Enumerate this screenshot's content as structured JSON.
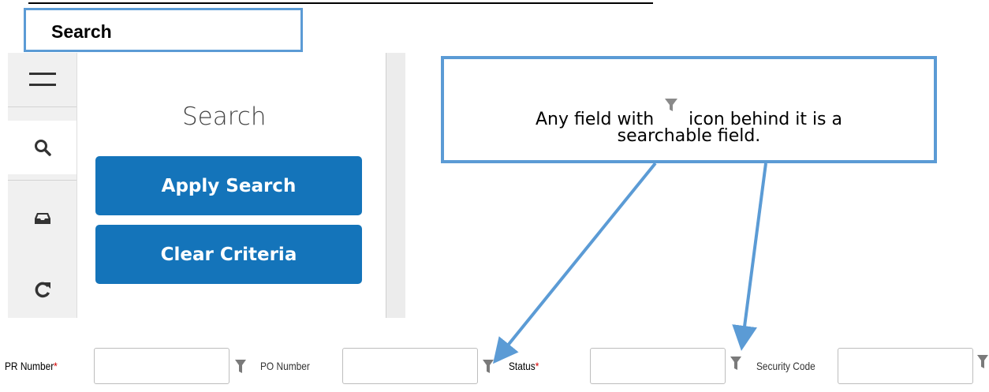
{
  "header": {
    "title": "Search"
  },
  "sidebar": {
    "icons": [
      "menu-icon",
      "search-icon",
      "inbox-icon",
      "refresh-icon"
    ],
    "heading": "Search",
    "apply_label": "Apply Search",
    "clear_label": "Clear Criteria"
  },
  "callout": {
    "line1_before": "Any field with",
    "line1_after": "icon behind it is a",
    "line2": "searchable field."
  },
  "fields": [
    {
      "label": "PR Number",
      "required": "*",
      "value": ""
    },
    {
      "label": "PO Number",
      "required": "",
      "value": ""
    },
    {
      "label": "Status",
      "required": "*",
      "value": ""
    },
    {
      "label": "Security Code",
      "required": "",
      "value": ""
    }
  ],
  "colors": {
    "accent": "#1474ba",
    "callout_border": "#5b9bd5",
    "required": "#d40000"
  }
}
